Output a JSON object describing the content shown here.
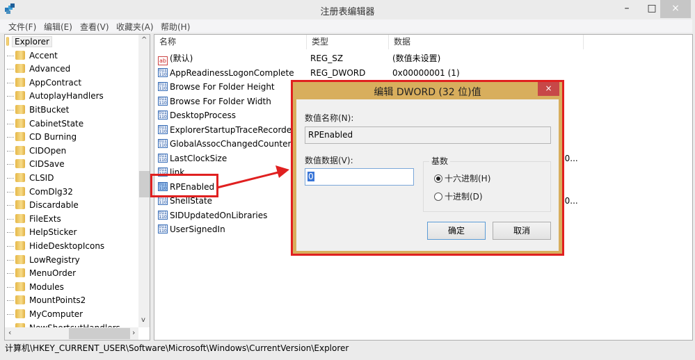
{
  "window": {
    "title": "注册表编辑器",
    "minimize": "–",
    "maximize": "□",
    "close": "×"
  },
  "menu": [
    "文件(F)",
    "编辑(E)",
    "查看(V)",
    "收藏夹(A)",
    "帮助(H)"
  ],
  "tree": {
    "items": [
      "Explorer",
      "Accent",
      "Advanced",
      "AppContract",
      "AutoplayHandlers",
      "BitBucket",
      "CabinetState",
      "CD Burning",
      "CIDOpen",
      "CIDSave",
      "CLSID",
      "ComDlg32",
      "Discardable",
      "FileExts",
      "HelpSticker",
      "HideDesktopIcons",
      "LowRegistry",
      "MenuOrder",
      "Modules",
      "MountPoints2",
      "MyComputer",
      "NewShortcutHandlers"
    ]
  },
  "list": {
    "headers": [
      "名称",
      "类型",
      "数据"
    ],
    "rows": [
      {
        "name": "(默认)",
        "type": "REG_SZ",
        "data": "(数值未设置)",
        "icon": "string"
      },
      {
        "name": "AppReadinessLogonComplete",
        "type": "REG_DWORD",
        "data": "0x00000001 (1)",
        "icon": "binary"
      },
      {
        "name": "Browse For Folder Height",
        "type": "",
        "data": "",
        "icon": "binary"
      },
      {
        "name": "Browse For Folder Width",
        "type": "",
        "data": "",
        "icon": "binary"
      },
      {
        "name": "DesktopProcess",
        "type": "",
        "data": "",
        "icon": "binary"
      },
      {
        "name": "ExplorerStartupTraceRecorded",
        "type": "",
        "data": "",
        "icon": "binary"
      },
      {
        "name": "GlobalAssocChangedCounter",
        "type": "",
        "data": "",
        "icon": "binary"
      },
      {
        "name": "LastClockSize",
        "type": "",
        "data": "00...",
        "icon": "binary"
      },
      {
        "name": "link",
        "type": "",
        "data": "",
        "icon": "binary"
      },
      {
        "name": "RPEnabled",
        "type": "",
        "data": "",
        "icon": "binary"
      },
      {
        "name": "ShellState",
        "type": "",
        "data": "00...",
        "icon": "binary"
      },
      {
        "name": "SIDUpdatedOnLibraries",
        "type": "",
        "data": "",
        "icon": "binary"
      },
      {
        "name": "UserSignedIn",
        "type": "",
        "data": "",
        "icon": "binary"
      }
    ]
  },
  "status": "计算机\\HKEY_CURRENT_USER\\Software\\Microsoft\\Windows\\CurrentVersion\\Explorer",
  "dialog": {
    "title": "编辑 DWORD (32 位)值",
    "close": "×",
    "name_label": "数值名称(N):",
    "name_value": "RPEnabled",
    "data_label": "数值数据(V):",
    "data_value": "0",
    "radix_label": "基数",
    "radix_options": [
      {
        "label": "十六进制(H)",
        "selected": true
      },
      {
        "label": "十进制(D)",
        "selected": false
      }
    ],
    "ok": "确定",
    "cancel": "取消"
  },
  "colors": {
    "annotation": "#e02020",
    "dialog_frame": "#d8ae5d",
    "close_button": "#c74848"
  }
}
